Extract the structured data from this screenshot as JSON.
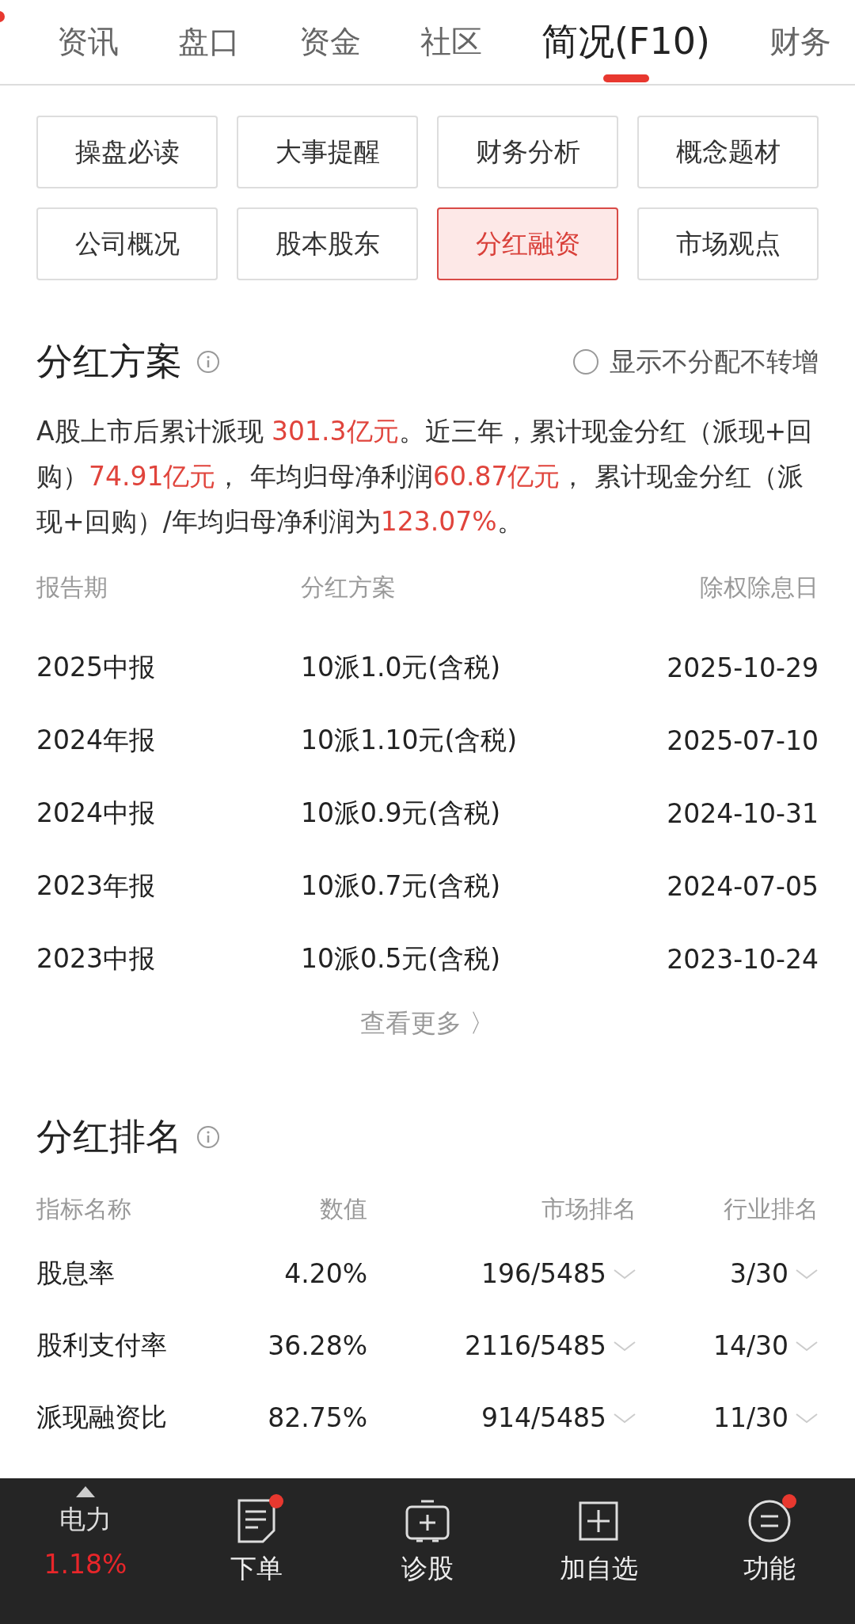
{
  "tabs": [
    {
      "label": "资讯",
      "selected": false
    },
    {
      "label": "盘口",
      "selected": false
    },
    {
      "label": "资金",
      "selected": false
    },
    {
      "label": "社区",
      "selected": false
    },
    {
      "label": "简况(F10)",
      "selected": true
    },
    {
      "label": "财务",
      "selected": false
    }
  ],
  "sub_tabs": [
    {
      "label": "操盘必读",
      "selected": false
    },
    {
      "label": "大事提醒",
      "selected": false
    },
    {
      "label": "财务分析",
      "selected": false
    },
    {
      "label": "概念题材",
      "selected": false
    },
    {
      "label": "公司概况",
      "selected": false
    },
    {
      "label": "股本股东",
      "selected": false
    },
    {
      "label": "分红融资",
      "selected": true
    },
    {
      "label": "市场观点",
      "selected": false
    }
  ],
  "dividend_plan": {
    "title": "分红方案",
    "filter": {
      "label": "显示不分配不转增",
      "checked": false
    },
    "summary": [
      {
        "text": "A股上市后累计派现 ",
        "highlight": false
      },
      {
        "text": "301.3亿元",
        "highlight": true
      },
      {
        "text": "。近三年，累计现金分红（派现+回购）",
        "highlight": false
      },
      {
        "text": "74.91亿元",
        "highlight": true
      },
      {
        "text": "， 年均归母净利润",
        "highlight": false
      },
      {
        "text": "60.87亿元",
        "highlight": true
      },
      {
        "text": "， 累计现金分红（派现+回购）/年均归母净利润为",
        "highlight": false
      },
      {
        "text": "123.07%",
        "highlight": true
      },
      {
        "text": "。",
        "highlight": false
      }
    ],
    "columns": [
      "报告期",
      "分红方案",
      "除权除息日"
    ],
    "rows": [
      [
        "2025中报",
        "10派1.0元(含税)",
        "2025-10-29"
      ],
      [
        "2024年报",
        "10派1.10元(含税)",
        "2025-07-10"
      ],
      [
        "2024中报",
        "10派0.9元(含税)",
        "2024-10-31"
      ],
      [
        "2023年报",
        "10派0.7元(含税)",
        "2024-07-05"
      ],
      [
        "2023中报",
        "10派0.5元(含税)",
        "2023-10-24"
      ]
    ],
    "more": "查看更多 〉"
  },
  "dividend_rank": {
    "title": "分红排名",
    "columns": [
      "指标名称",
      "数值",
      "市场排名",
      "行业排名"
    ],
    "rows": [
      [
        "股息率",
        "4.20%",
        "196/5485",
        "3/30"
      ],
      [
        "股利支付率",
        "36.28%",
        "2116/5485",
        "14/30"
      ],
      [
        "派现融资比",
        "82.75%",
        "914/5485",
        "11/30"
      ]
    ]
  },
  "bottom_bar": {
    "stock": {
      "name": "电力",
      "change": "1.18%"
    },
    "items": [
      {
        "label": "下单",
        "badge": true
      },
      {
        "label": "诊股",
        "badge": false
      },
      {
        "label": "加自选",
        "badge": false
      },
      {
        "label": "功能",
        "badge": true
      }
    ]
  }
}
